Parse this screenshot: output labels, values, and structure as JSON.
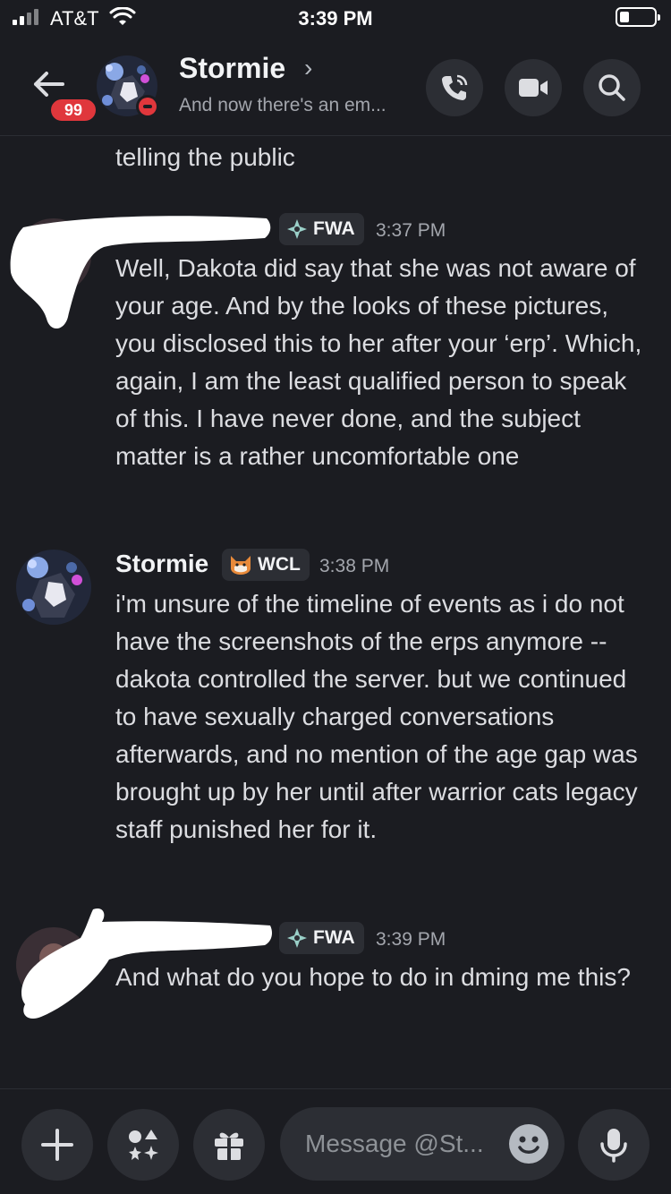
{
  "status_bar": {
    "carrier": "AT&T",
    "time": "3:39 PM"
  },
  "header": {
    "unread_count": "99",
    "name": "Stormie",
    "chevron": "›",
    "status_text": "And now there's an em...",
    "icons": [
      "back-arrow-icon",
      "phone-call-icon",
      "video-camera-icon",
      "search-icon"
    ]
  },
  "messages": [
    {
      "text": "telling the public",
      "continuation": true
    },
    {
      "author": "",
      "author_redacted": true,
      "tag": "FWA",
      "tag_icon": "crosshair-diamond-icon",
      "time": "3:37 PM",
      "text": "Well, Dakota did say that she was not aware of your age. And by the looks of these pictures, you disclosed this to her after your ‘erp’. Which, again, I am the least qualified person to speak of this. I have never done, and the subject matter is a rather uncomfortable one"
    },
    {
      "author": "Stormie",
      "tag": "WCL",
      "tag_icon": "cat-face-icon",
      "time": "3:38 PM",
      "text": "i'm unsure of the timeline of events as i do not have the screenshots of the erps anymore -- dakota controlled the server. but we continued to have sexually charged conversations afterwards, and no mention of the age gap was brought up by her until after warrior cats legacy staff punished her for it."
    },
    {
      "author": "",
      "author_redacted": true,
      "tag": "FWA",
      "tag_icon": "crosshair-diamond-icon",
      "time": "3:39 PM",
      "text": "And what do you hope to do in dming me this?"
    }
  ],
  "composer": {
    "placeholder": "Message @St...",
    "icons": [
      "plus-icon",
      "apps-icon",
      "gift-icon",
      "emoji-icon",
      "microphone-icon"
    ]
  },
  "colors": {
    "background": "#1b1c21",
    "button_bg": "#2c2e34",
    "badge_red": "#e0373c",
    "text": "#dcdde1",
    "muted": "#a3a6ad"
  }
}
